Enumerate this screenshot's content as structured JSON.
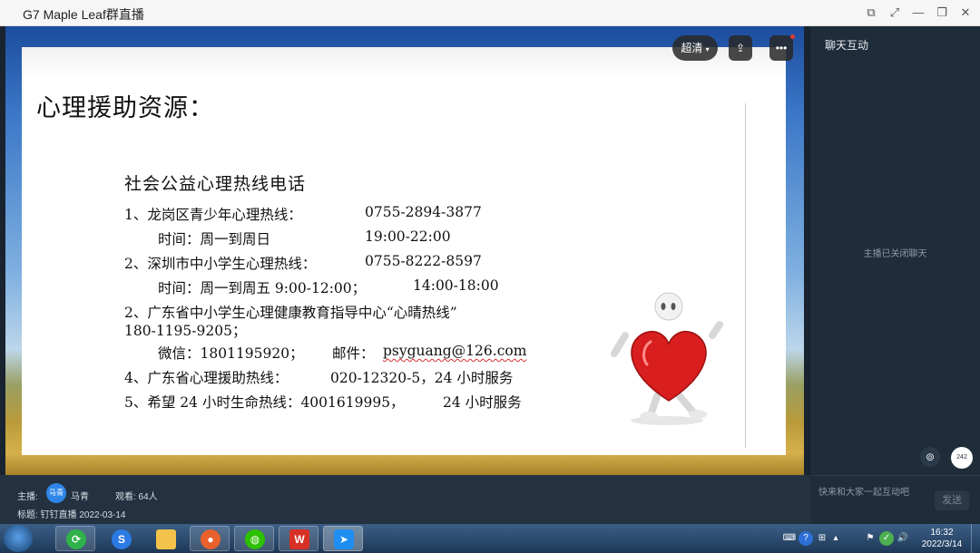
{
  "window": {
    "title": "G7 Maple Leaf群直播"
  },
  "player": {
    "quality_label": "超清"
  },
  "slide": {
    "title": "心理援助资源：",
    "heading": "社会公益心理热线电话",
    "lines": [
      "1、龙岗区青少年心理热线：",
      "0755-2894-3877",
      "时间：周一到周日",
      "19:00-22:00",
      "2、深圳市中小学生心理热线：",
      "0755-8222-8597",
      "时间：周一到周五 9:00-12:00；",
      "14:00-18:00",
      "2、广东省中小学生心理健康教育指导中心“心晴热线”",
      "180-1195-9205；",
      "微信：1801195920；",
      "邮件：",
      "psyguang@126.com",
      "4、广东省心理援助热线：",
      "020-12320-5，24 小时服务",
      "5、希望 24 小时生命热线：4001619995，",
      "24 小时服务"
    ]
  },
  "chat": {
    "header": "聊天互动",
    "closed_notice": "主播已关闭聊天",
    "viewer_badge": "242",
    "input_placeholder": "快来和大家一起互动吧",
    "send_label": "发送"
  },
  "info": {
    "host_label": "主播:",
    "host_avatar_text": "马青",
    "host_name": "马青",
    "viewers": "观看: 64人",
    "subject": "标题: 钉钉直播 2022-03-14"
  },
  "taskbar": {
    "time": "16:32",
    "date": "2022/3/14"
  }
}
